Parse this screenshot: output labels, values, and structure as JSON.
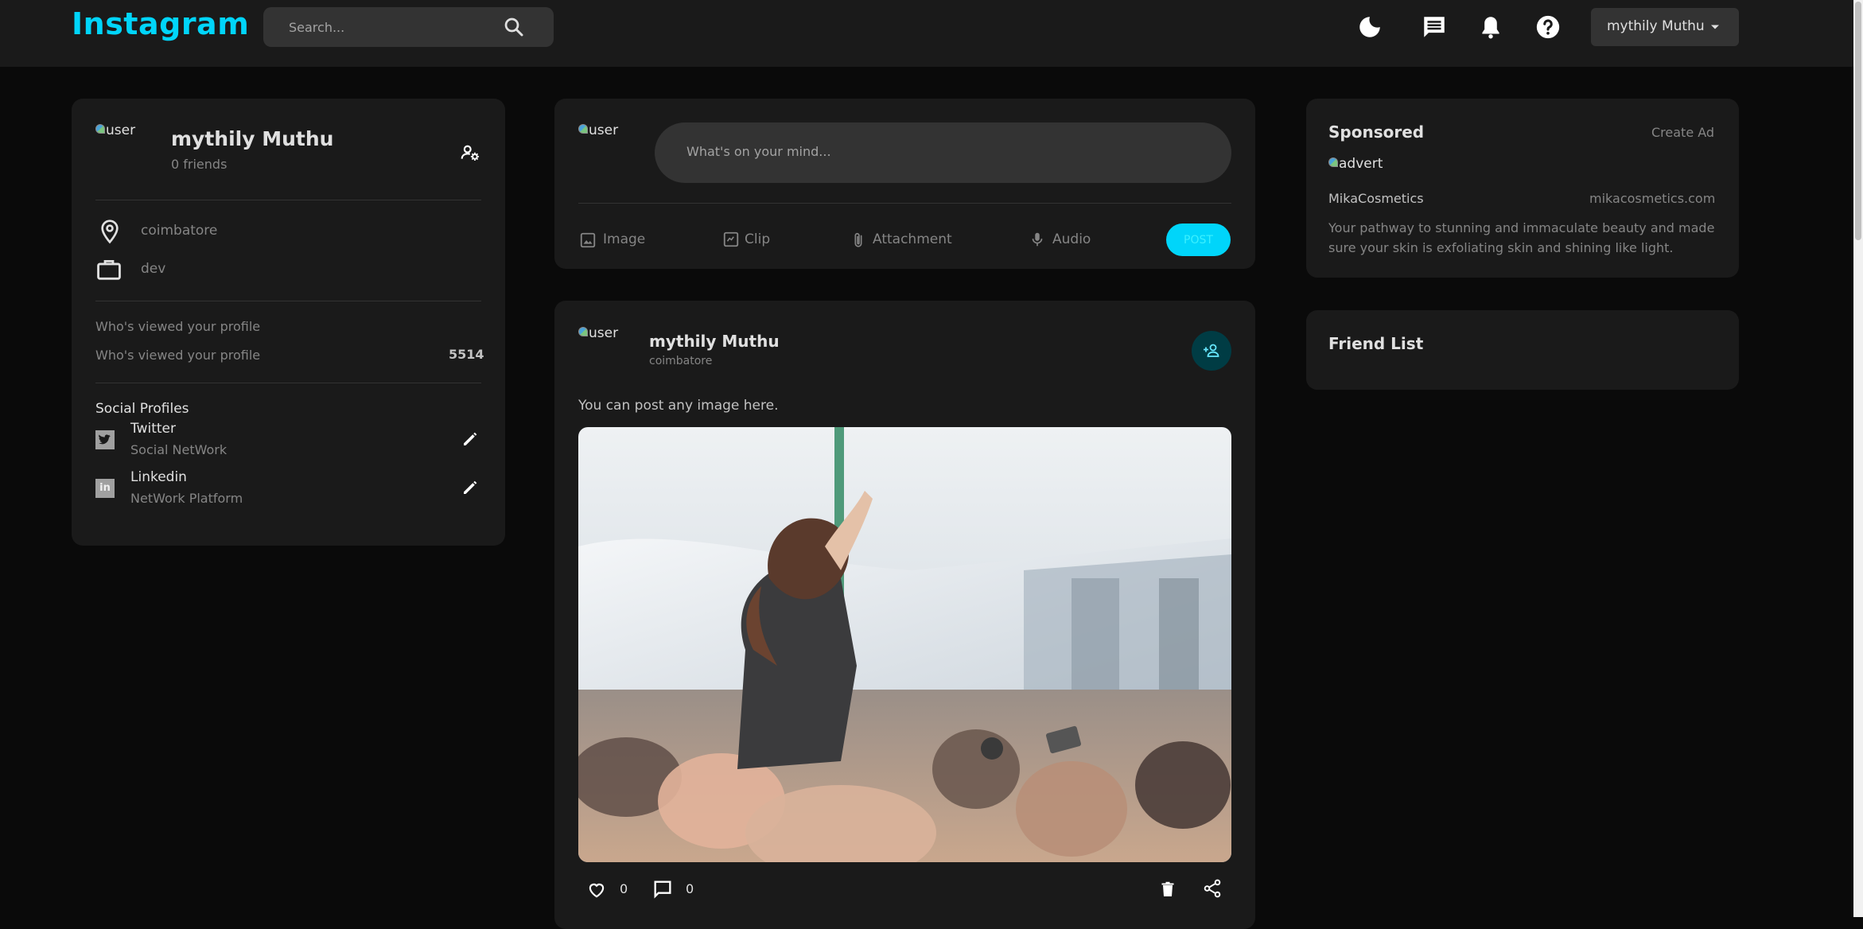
{
  "navbar": {
    "brand": "Instagram",
    "search_placeholder": "Search...",
    "user_menu_label": "mythily Muthu",
    "icons": [
      "dark-mode-icon",
      "message-icon",
      "notification-icon",
      "help-icon"
    ]
  },
  "profile": {
    "avatar_alt": "user",
    "name": "mythily Muthu",
    "friends": "0 friends",
    "location": "coimbatore",
    "occupation": "dev",
    "viewed_label_1": "Who's viewed your profile",
    "viewed_label_2": "Who's viewed your profile",
    "viewed_count": "5514",
    "social_title": "Social Profiles",
    "social": [
      {
        "name": "Twitter",
        "type": "Social NetWork"
      },
      {
        "name": "Linkedin",
        "type": "NetWork Platform"
      }
    ]
  },
  "composer": {
    "avatar_alt": "user",
    "placeholder": "What's on your mind...",
    "actions": [
      "Image",
      "Clip",
      "Attachment",
      "Audio"
    ],
    "post_label": "POST"
  },
  "post": {
    "avatar_alt": "user",
    "author": "mythily Muthu",
    "location": "coimbatore",
    "description": "You can post any image here.",
    "likes": "0",
    "comments": "0"
  },
  "sponsored": {
    "title": "Sponsored",
    "create_ad": "Create Ad",
    "image_alt": "advert",
    "brand": "MikaCosmetics",
    "site": "mikacosmetics.com",
    "text_line1": "Your pathway to stunning and immaculate beauty and made",
    "text_line2": "sure your skin is exfoliating skin and shining like light."
  },
  "friend_list": {
    "title": "Friend List"
  },
  "colors": {
    "accent": "#00d5fa",
    "background": "#0a0a0a",
    "card": "#1a1a1a",
    "input": "#333333"
  }
}
